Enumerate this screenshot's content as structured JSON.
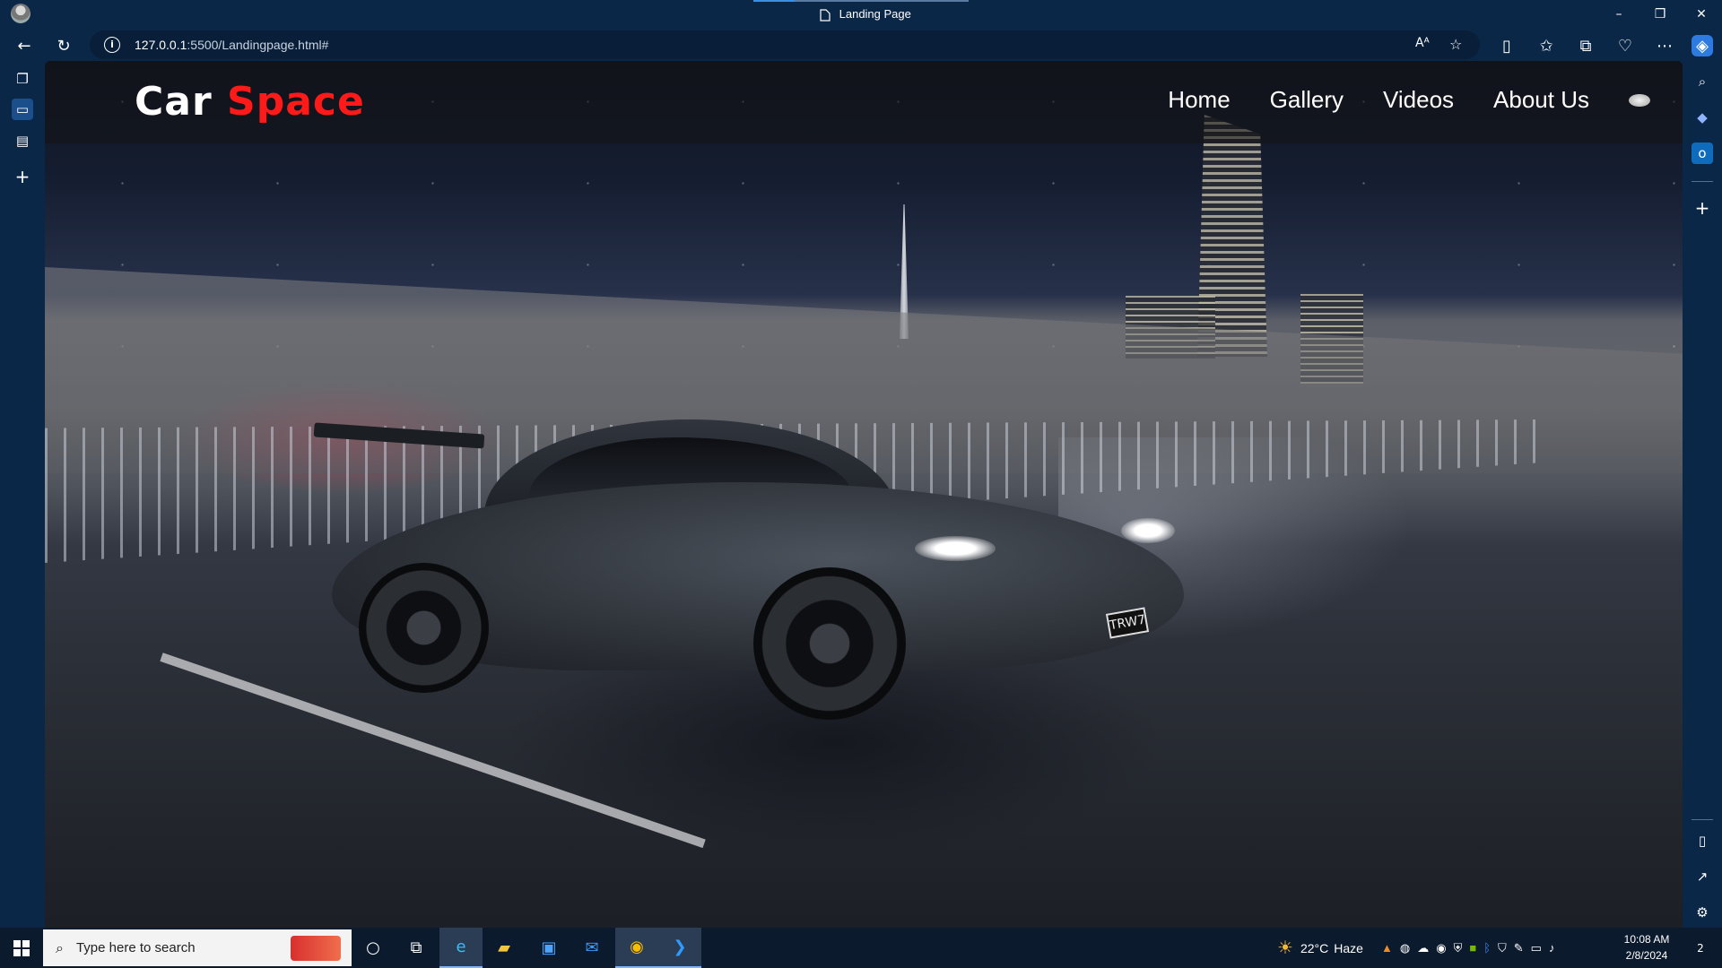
{
  "browser": {
    "tab_title": "Landing Page",
    "url_host": "127.0.0.1",
    "url_path": ":5500/Landingpage.html#",
    "nav_icons": [
      "back-icon",
      "refresh-icon"
    ],
    "window_buttons": [
      "–",
      "❒",
      "✕"
    ],
    "toolbar_icons": [
      "read-aloud-icon",
      "favorite-star-icon",
      "split-screen-icon",
      "favorites-icon",
      "collections-icon",
      "browser-essentials-icon",
      "more-icon",
      "copilot-icon"
    ],
    "read_aloud_glyph": "Aᴬ"
  },
  "site": {
    "logo_primary": "Car",
    "logo_accent": "Space",
    "accent_color": "#ff1a1a",
    "menu": [
      "Home",
      "Gallery",
      "Videos",
      "About Us"
    ],
    "plate_text": "TRW7"
  },
  "taskbar": {
    "search_placeholder": "Type here to search",
    "weather_temp": "22°C",
    "weather_desc": "Haze",
    "time": "10:08 AM",
    "date": "2/8/2024",
    "notifications": "2"
  }
}
